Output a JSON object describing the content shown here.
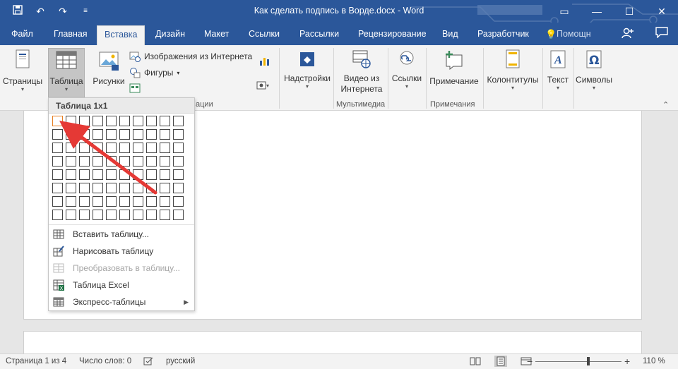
{
  "titlebar": {
    "title": "Как сделать подпись в Ворде.docx - Word",
    "qat": {
      "save_icon": "save-icon",
      "undo_icon": "undo-icon",
      "redo_icon": "redo-icon",
      "customize_icon": "customize-icon"
    },
    "window_buttons": {
      "ribbon_options": "▭",
      "minimize": "—",
      "maximize": "☐",
      "close": "✕"
    }
  },
  "tabs": [
    "Файл",
    "Главная",
    "Вставка",
    "Дизайн",
    "Макет",
    "Ссылки",
    "Рассылки",
    "Рецензирование",
    "Вид",
    "Разработчик"
  ],
  "active_tab": "Вставка",
  "tell_me": "Помощн",
  "ribbon": {
    "pages": "Страницы",
    "table": "Таблица",
    "pictures": "Рисунки",
    "online_pictures": "Изображения из Интернета",
    "shapes": "Фигуры",
    "addins": "Надстройки",
    "online_video": "Видео из\nИнтернета",
    "online_video_line1": "Видео из",
    "online_video_line2": "Интернета",
    "links": "Ссылки",
    "comment": "Примечание",
    "header_footer": "Колонтитулы",
    "text": "Текст",
    "symbols": "Символы",
    "group_illustrations_tail": "ации",
    "group_media": "Мультимедиа",
    "group_comments": "Примечания"
  },
  "dropdown": {
    "header": "Таблица 1x1",
    "grid": {
      "cols": 10,
      "rows": 8,
      "selected_cols": 1,
      "selected_rows": 1
    },
    "items": [
      {
        "label": "Вставить таблицу...",
        "enabled": true
      },
      {
        "label": "Нарисовать таблицу",
        "enabled": true
      },
      {
        "label": "Преобразовать в таблицу...",
        "enabled": false
      },
      {
        "label": "Таблица Excel",
        "enabled": true
      },
      {
        "label": "Экспресс-таблицы",
        "enabled": true,
        "submenu": true
      }
    ]
  },
  "statusbar": {
    "page": "Страница 1 из 4",
    "words": "Число слов: 0",
    "language": "русский",
    "zoom": "110 %",
    "zoom_minus": "−",
    "zoom_plus": "+"
  },
  "colors": {
    "accent": "#2b579a",
    "arrow": "#e53935",
    "cell_selected": "#e67e22"
  }
}
